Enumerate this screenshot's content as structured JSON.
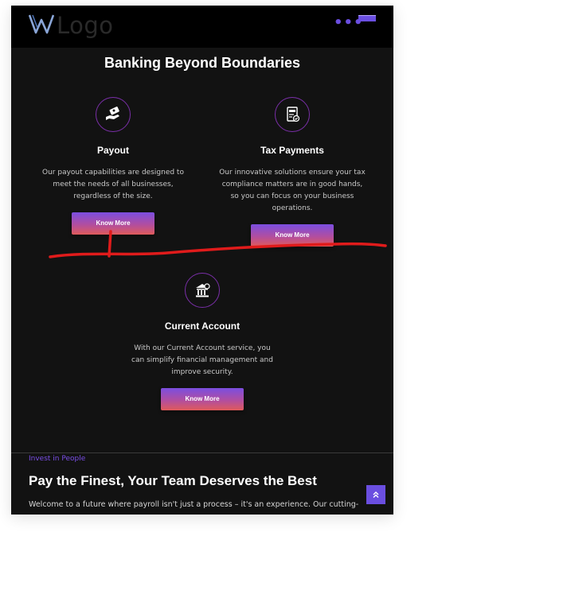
{
  "header": {
    "logo_text": "Logo",
    "logo_icon": "w-logo-icon",
    "menu_icon": "more-dots-icon"
  },
  "section": {
    "title": "Banking Beyond Boundaries"
  },
  "cards": [
    {
      "icon": "payout-hand-money-icon",
      "title": "Payout",
      "description": "Our payout capabilities are designed to meet the needs of all businesses, regardless of the size.",
      "button": "Know More"
    },
    {
      "icon": "tax-document-icon",
      "title": "Tax Payments",
      "description": "Our innovative solutions ensure your tax compliance matters are in good hands, so you can focus on your business operations.",
      "button": "Know More"
    },
    {
      "icon": "bank-building-icon",
      "title": "Current Account",
      "description": "With our Current Account service, you can simplify financial management and improve security.",
      "button": "Know More"
    }
  ],
  "invest": {
    "eyebrow": "Invest in People",
    "headline": "Pay the Finest, Your Team Deserves the Best",
    "intro": "Welcome to a future where payroll isn't just a process – it's an experience. Our cutting-"
  },
  "scroll_top_icon": "double-chevron-up-icon",
  "colors": {
    "accent": "#6a4ee0",
    "background": "#121212",
    "annotation_stroke": "#e01b1b"
  }
}
